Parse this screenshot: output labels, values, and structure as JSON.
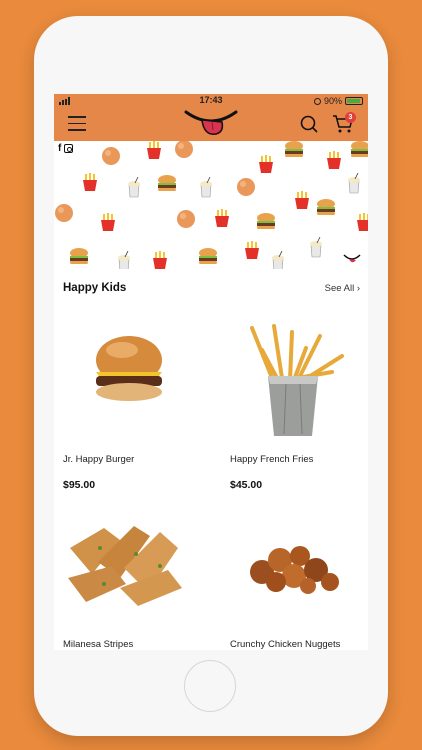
{
  "status": {
    "time": "17:43",
    "battery": "90%"
  },
  "header": {
    "cart_count": "3"
  },
  "section": {
    "title": "Happy Kids",
    "see_all": "See All"
  },
  "products": [
    {
      "name": "Jr. Happy Burger",
      "price": "$95.00"
    },
    {
      "name": "Happy French Fries",
      "price": "$45.00"
    },
    {
      "name": "Milanesa Stripes"
    },
    {
      "name": "Crunchy Chicken Nuggets"
    }
  ],
  "icons": [
    "menu-icon",
    "logo-mouth-icon",
    "search-icon",
    "cart-icon",
    "facebook-icon",
    "instagram-icon"
  ],
  "colors": {
    "background": "#e98a3c",
    "header": "#e6874a",
    "badge": "#e0403a"
  }
}
